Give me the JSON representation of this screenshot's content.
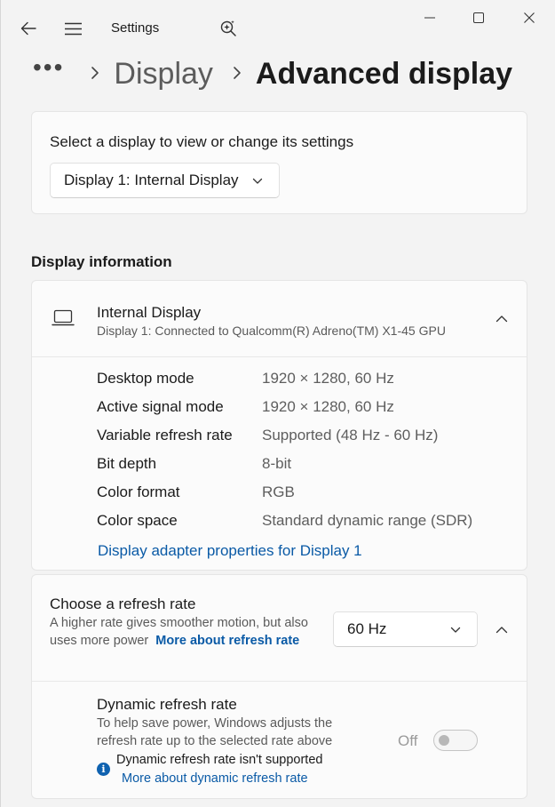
{
  "app": {
    "title": "Settings"
  },
  "breadcrumb": {
    "more": "•••",
    "parent": "Display",
    "current": "Advanced display"
  },
  "select_display": {
    "label": "Select a display to view or change its settings",
    "selected": "Display 1: Internal Display"
  },
  "display_information": {
    "header": "Display information",
    "title": "Internal Display",
    "subtitle": "Display 1: Connected to Qualcomm(R) Adreno(TM) X1-45 GPU",
    "properties": [
      {
        "name": "Desktop mode",
        "value": "1920 × 1280, 60 Hz"
      },
      {
        "name": "Active signal mode",
        "value": "1920 × 1280, 60 Hz"
      },
      {
        "name": "Variable refresh rate",
        "value": "Supported (48 Hz - 60 Hz)"
      },
      {
        "name": "Bit depth",
        "value": "8-bit"
      },
      {
        "name": "Color format",
        "value": "RGB"
      },
      {
        "name": "Color space",
        "value": "Standard dynamic range (SDR)"
      }
    ],
    "adapter_link": "Display adapter properties for Display 1"
  },
  "refresh_rate": {
    "title": "Choose a refresh rate",
    "description": "A higher rate gives smoother motion, but also uses more power",
    "link": "More about refresh rate",
    "selected": "60 Hz"
  },
  "dynamic_refresh": {
    "title": "Dynamic refresh rate",
    "description": "To help save power, Windows adjusts the refresh rate up to the selected rate above",
    "toggle_label": "Off",
    "toggle_on": false,
    "notice": "Dynamic refresh rate isn't supported",
    "notice_link": "More about dynamic refresh rate"
  },
  "icons": {
    "back": "back-arrow-icon",
    "menu": "hamburger-menu-icon",
    "search": "search-sparkle-icon",
    "laptop": "laptop-icon",
    "info": "info-icon"
  },
  "colors": {
    "accent": "#0a5aa6",
    "info": "#0f62b0",
    "background": "#f3f3f3",
    "card": "#fbfbfb"
  }
}
